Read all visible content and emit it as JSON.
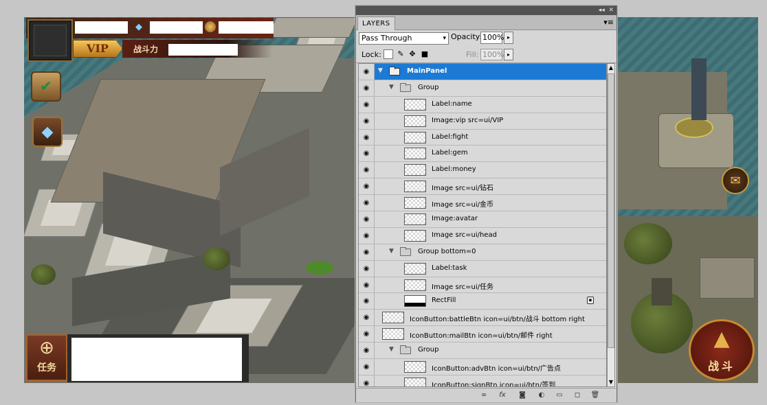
{
  "game": {
    "vip_label": "VIP",
    "fight_label": "战斗力",
    "task_label": "任务",
    "battle_label": "战斗",
    "icons": {
      "gem": "diamond-icon",
      "coin": "gold-coin-icon",
      "quest": "quest-book-icon",
      "ad": "treasure-chest-icon",
      "mail": "mail-icon",
      "battle": "tank-emblem-icon",
      "task": "task-emblem-icon"
    }
  },
  "layers_panel": {
    "tab_label": "LAYERS",
    "blend_mode": "Pass Through",
    "opacity_label": "Opacity:",
    "opacity_value": "100%",
    "lock_label": "Lock:",
    "fill_label": "Fill:",
    "fill_value": "100%",
    "layers": [
      {
        "name": "MainPanel",
        "kind": "group",
        "expanded": true,
        "depth": 0,
        "selected": true
      },
      {
        "name": "Group",
        "kind": "group",
        "expanded": true,
        "depth": 1
      },
      {
        "name": "Label:name",
        "kind": "layer",
        "depth": 2
      },
      {
        "name": "Image:vip src=ui/VIP",
        "kind": "layer",
        "depth": 2
      },
      {
        "name": "Label:fight",
        "kind": "layer",
        "depth": 2
      },
      {
        "name": "Label:gem",
        "kind": "layer",
        "depth": 2
      },
      {
        "name": "Label:money",
        "kind": "layer",
        "depth": 2
      },
      {
        "name": "Image src=ui/钻石",
        "kind": "layer",
        "depth": 2
      },
      {
        "name": "Image src=ui/金币",
        "kind": "layer",
        "depth": 2
      },
      {
        "name": "Image:avatar",
        "kind": "layer",
        "depth": 2
      },
      {
        "name": "Image src=ui/head",
        "kind": "layer",
        "depth": 2
      },
      {
        "name": "Group bottom=0",
        "kind": "group",
        "expanded": true,
        "depth": 1
      },
      {
        "name": "Label:task",
        "kind": "layer",
        "depth": 2
      },
      {
        "name": "Image src=ui/任务",
        "kind": "layer",
        "depth": 2
      },
      {
        "name": "RectFill",
        "kind": "layer",
        "depth": 2,
        "locked": true,
        "dark": true
      },
      {
        "name": "IconButton:battleBtn icon=ui/btn/战斗 bottom right",
        "kind": "layer",
        "depth": 1
      },
      {
        "name": "IconButton:mailBtn icon=ui/btn/邮件 right",
        "kind": "layer",
        "depth": 1
      },
      {
        "name": "Group",
        "kind": "group",
        "expanded": true,
        "depth": 1
      },
      {
        "name": "IconButton:advBtn icon=ui/btn/广告点",
        "kind": "layer",
        "depth": 2
      },
      {
        "name": "IconButton:signBtn icon=ui/btn/签到",
        "kind": "layer",
        "depth": 2
      }
    ]
  }
}
